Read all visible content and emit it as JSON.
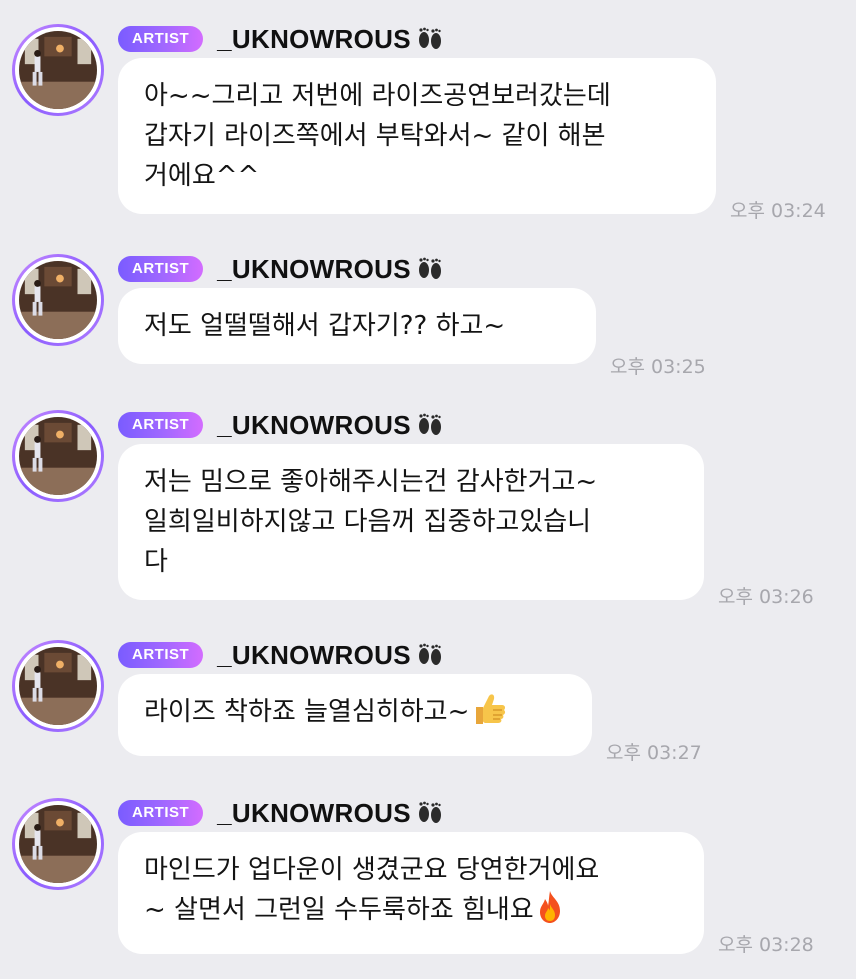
{
  "messages": [
    {
      "badge": "ARTIST",
      "username": "_UKNOWROUS",
      "text": "아~~그리고 저번에 라이즈공연보러갔는데\n갑자기 라이즈쪽에서 부탁와서~ 같이 해본\n거에요^^",
      "time": "오후 03:24",
      "emoji": ""
    },
    {
      "badge": "ARTIST",
      "username": "_UKNOWROUS",
      "text": "저도 얼떨떨해서 갑자기?? 하고~",
      "time": "오후 03:25",
      "emoji": ""
    },
    {
      "badge": "ARTIST",
      "username": "_UKNOWROUS",
      "text": "저는 밈으로 좋아해주시는건 감사한거고~\n일희일비하지않고 다음꺼 집중하고있습니\n다",
      "time": "오후 03:26",
      "emoji": ""
    },
    {
      "badge": "ARTIST",
      "username": "_UKNOWROUS",
      "text": "라이즈 착하죠 늘열심히하고~",
      "time": "오후 03:27",
      "emoji": "thumbs-up-icon"
    },
    {
      "badge": "ARTIST",
      "username": "_UKNOWROUS",
      "text": "마인드가 업다운이 생겼군요 당연한거에요\n~ 살면서 그런일 수두룩하죠 힘내요",
      "time": "오후 03:28",
      "emoji": "fire-icon"
    }
  ],
  "icons": {
    "username_suffix": "footprints-icon"
  },
  "colors": {
    "background": "#ececf0",
    "bubble": "#ffffff",
    "badge_start": "#7a5cff",
    "badge_end": "#d36cff",
    "time_text": "#a7a7ad"
  }
}
